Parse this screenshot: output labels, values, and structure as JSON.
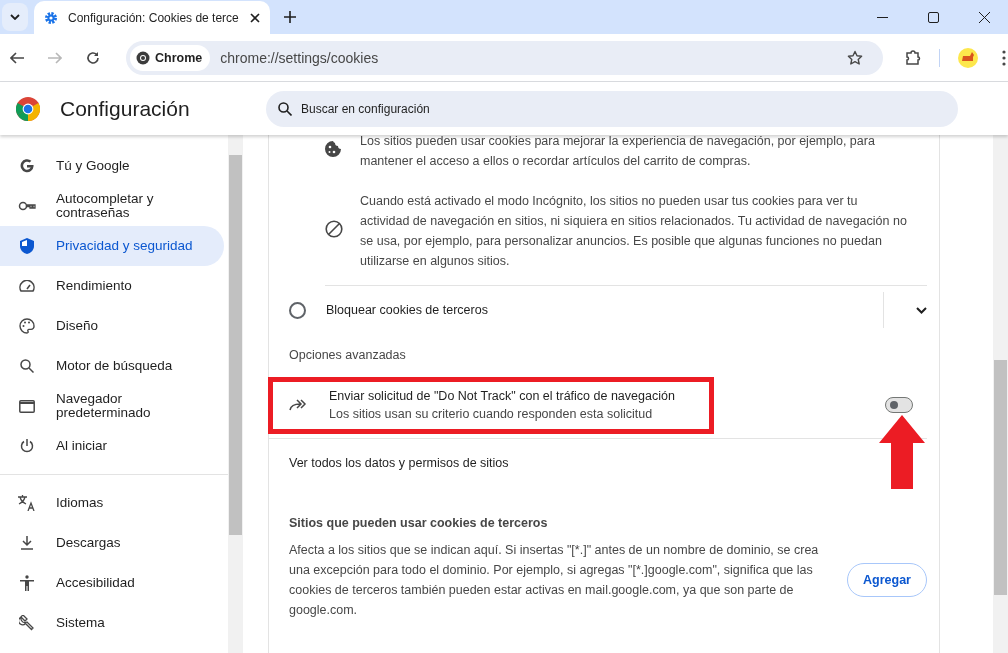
{
  "tab": {
    "title": "Configuración: Cookies de terce",
    "selected": true
  },
  "toolbar": {
    "chip": "Chrome",
    "url": "chrome://settings/cookies"
  },
  "header": {
    "title": "Configuración",
    "search": {
      "placeholder": "Buscar en configuración"
    }
  },
  "sidebar": {
    "items": [
      {
        "label": "Tú y Google",
        "selected": false
      },
      {
        "label": "Autocompletar y contraseñas",
        "selected": false
      },
      {
        "label": "Privacidad y seguridad",
        "selected": true
      },
      {
        "label": "Rendimiento",
        "selected": false
      },
      {
        "label": "Diseño",
        "selected": false
      },
      {
        "label": "Motor de búsqueda",
        "selected": false
      },
      {
        "label": "Navegador predeterminado",
        "selected": false
      },
      {
        "label": "Al iniciar",
        "selected": false
      },
      {
        "label": "Idiomas",
        "selected": false
      },
      {
        "label": "Descargas",
        "selected": false
      },
      {
        "label": "Accesibilidad",
        "selected": false
      },
      {
        "label": "Sistema",
        "selected": false
      }
    ]
  },
  "content": {
    "notes": [
      {
        "kind": "cookie",
        "text": "Los sitios pueden usar cookies para mejorar la experiencia de navegación, por ejemplo, para mantener el acceso a ellos o recordar artículos del carrito de compras."
      },
      {
        "kind": "block",
        "text": "Cuando está activado el modo Incógnito, los sitios no pueden usar tus cookies para ver tu actividad de navegación en sitios, ni siquiera en sitios relacionados. Tu actividad de navegación no se usa, por ejemplo, para personalizar anuncios. Es posible que algunas funciones no puedan utilizarse en algunos sitios."
      }
    ],
    "radio": {
      "label": "Bloquear cookies de terceros",
      "selected": false,
      "expanded": false
    },
    "advanced_heading": "Opciones avanzadas",
    "dnt": {
      "title": "Enviar solicitud de \"Do Not Track\" con el tráfico de navegación",
      "subtitle": "Los sitios usan su criterio cuando responden esta solicitud",
      "on": false
    },
    "link": "Ver todos los datos y permisos de sitios",
    "allowed": {
      "heading": "Sitios que pueden usar cookies de terceros",
      "text": "Afecta a los sitios que se indican aquí. Si insertas \"[*.]\" antes de un nombre de dominio, se crea una excepción para todo el dominio. Por ejemplo, si agregas \"[*.]google.com\", significa que las cookies de terceros también pueden estar activas en mail.google.com, ya que son parte de google.com.",
      "button": "Agregar"
    }
  }
}
